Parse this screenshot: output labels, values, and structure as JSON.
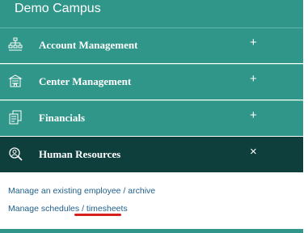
{
  "app": {
    "title": "Demo Campus"
  },
  "menu": {
    "items": [
      {
        "label": "Account Management",
        "icon": "org-chart-icon",
        "toggle": "+"
      },
      {
        "label": "Center Management",
        "icon": "building-icon",
        "toggle": "+"
      },
      {
        "label": "Financials",
        "icon": "documents-icon",
        "toggle": "+"
      },
      {
        "label": "Human Resources",
        "icon": "magnifier-person-icon",
        "toggle": "×",
        "expanded": true
      }
    ]
  },
  "submenu": {
    "line1": {
      "link_a": "Manage an existing employee",
      "sep": " / ",
      "link_b": "archive"
    },
    "line2": {
      "link_a": "Manage schedules",
      "sep": " / ",
      "link_b": "timesheets"
    }
  },
  "colors": {
    "accent": "#30968a",
    "active": "#0f3f3d",
    "link": "#1f5f8b",
    "annotation": "#d62020"
  }
}
